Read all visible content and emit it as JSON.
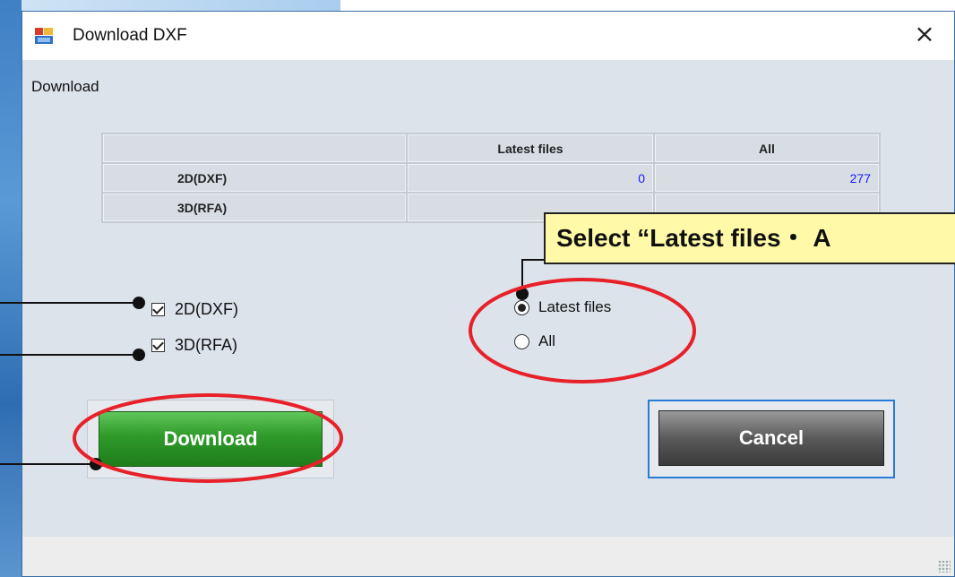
{
  "dialog": {
    "title": "Download DXF",
    "close_glyph": "×",
    "section_label": "Download"
  },
  "summary_table": {
    "headers": [
      "",
      "Latest files",
      "All"
    ],
    "rows": [
      {
        "label": "2D(DXF)",
        "latest": "0",
        "all": "277"
      },
      {
        "label": "3D(RFA)",
        "latest": "",
        "all": ""
      }
    ]
  },
  "options": {
    "checkboxes": [
      {
        "label": "2D(DXF)",
        "checked": true
      },
      {
        "label": "3D(RFA)",
        "checked": true
      }
    ],
    "radios": [
      {
        "label": "Latest files",
        "selected": true
      },
      {
        "label": "All",
        "selected": false
      }
    ]
  },
  "buttons": {
    "download_label": "Download",
    "cancel_label": "Cancel"
  },
  "annotation": {
    "callout_text": "Select “Latest files・ A"
  },
  "colors": {
    "highlight_ring": "#e8202a",
    "callout_bg": "#fff9a8",
    "number_text": "#1a1aff",
    "download_green": "#2f9a2a"
  }
}
